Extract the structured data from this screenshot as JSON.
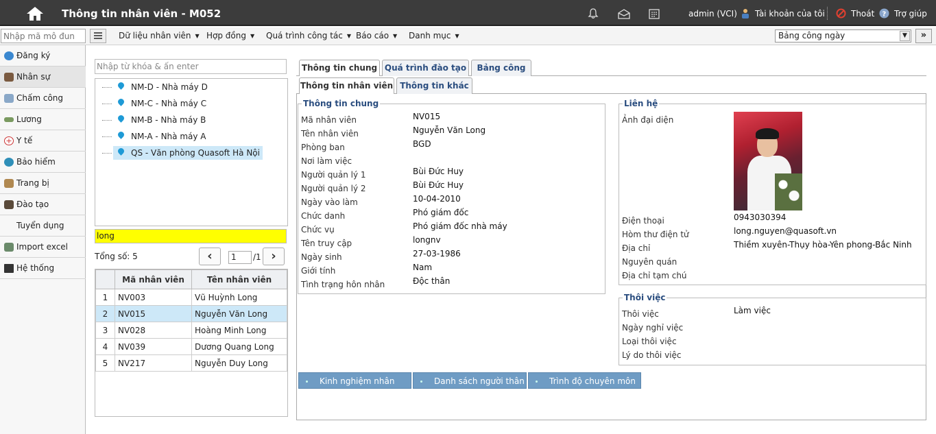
{
  "header": {
    "title": "Thông tin nhân viên - M052",
    "user": "admin (VCI)",
    "account_label": "Tài khoản của tôi",
    "logout_label": "Thoát",
    "help_label": "Trợ giúp"
  },
  "menubar": {
    "module_placeholder": "Nhập mã mô đun",
    "items": [
      "Dữ liệu nhân viên",
      "Hợp đồng",
      "Quá trình công tác",
      "Báo cáo",
      "Danh mục"
    ],
    "report_select": "Bảng công ngày"
  },
  "sidebar": {
    "items": [
      "Đăng ký",
      "Nhân sự",
      "Chấm công",
      "Lương",
      "Y tế",
      "Bảo hiểm",
      "Trang bị",
      "Đào tạo",
      "Tuyển dụng",
      "Import excel",
      "Hệ thống"
    ]
  },
  "tree": {
    "search_placeholder": "Nhập từ khóa & ấn enter",
    "nodes": [
      "NM-D - Nhà máy D",
      "NM-C - Nhà máy C",
      "NM-B - Nhà máy B",
      "NM-A - Nhà máy A",
      "QS - Văn phòng Quasoft Hà Nội"
    ]
  },
  "list": {
    "filter_value": "long",
    "total_label": "Tổng số: 5",
    "page_value": "1",
    "page_total": "/1",
    "columns": [
      "Mã nhân viên",
      "Tên nhân viên"
    ],
    "rows": [
      {
        "no": "1",
        "code": "NV003",
        "name": "Vũ Huỳnh Long"
      },
      {
        "no": "2",
        "code": "NV015",
        "name": "Nguyễn Văn Long"
      },
      {
        "no": "3",
        "code": "NV028",
        "name": "Hoàng Minh Long"
      },
      {
        "no": "4",
        "code": "NV039",
        "name": "Dương Quang Long"
      },
      {
        "no": "5",
        "code": "NV217",
        "name": "Nguyễn Duy Long"
      }
    ]
  },
  "tabs": {
    "main": [
      "Thông tin chung",
      "Quá trình đào tạo",
      "Bảng công"
    ],
    "sub": [
      "Thông tin nhân viên",
      "Thông tin khác"
    ]
  },
  "general": {
    "legend": "Thông tin chung",
    "labels": [
      "Mã nhân viên",
      "Tên nhân viên",
      "Phòng ban",
      "Nơi làm việc",
      "Người quản lý 1",
      "Người quản lý 2",
      "Ngày vào làm",
      "Chức danh",
      "Chức vụ",
      "Tên truy cập",
      "Ngày sinh",
      "Giới tính",
      "Tình trạng hôn nhân"
    ],
    "values": [
      "NV015",
      "Nguyễn Văn Long",
      "BGD",
      "",
      "Bùi Đức Huy",
      "Bùi Đức Huy",
      "10-04-2010",
      "Phó giám đốc",
      "Phó giám đốc nhà máy",
      "longnv",
      "27-03-1986",
      "Nam",
      "Độc thân"
    ]
  },
  "contact": {
    "legend": "Liên hệ",
    "avatar_label": "Ảnh đại diện",
    "labels": [
      "Điện thoại",
      "Hòm thư điện tử",
      "Địa chỉ",
      "Nguyên quán",
      "Địa chỉ tạm chú"
    ],
    "values": [
      "0943030394",
      "long.nguyen@quasoft.vn",
      "Thiềm xuyên-Thụy hòa-Yên phong-Bắc Ninh",
      "",
      ""
    ]
  },
  "resign": {
    "legend": "Thôi việc",
    "labels": [
      "Thôi việc",
      "Ngày nghỉ việc",
      "Loại thôi việc",
      "Lý do thôi việc"
    ],
    "values": [
      "Làm việc",
      "",
      "",
      ""
    ]
  },
  "bottom_buttons": [
    "Kinh nghiệm nhân viên",
    "Danh sách người thân",
    "Trình độ chuyên môn"
  ]
}
